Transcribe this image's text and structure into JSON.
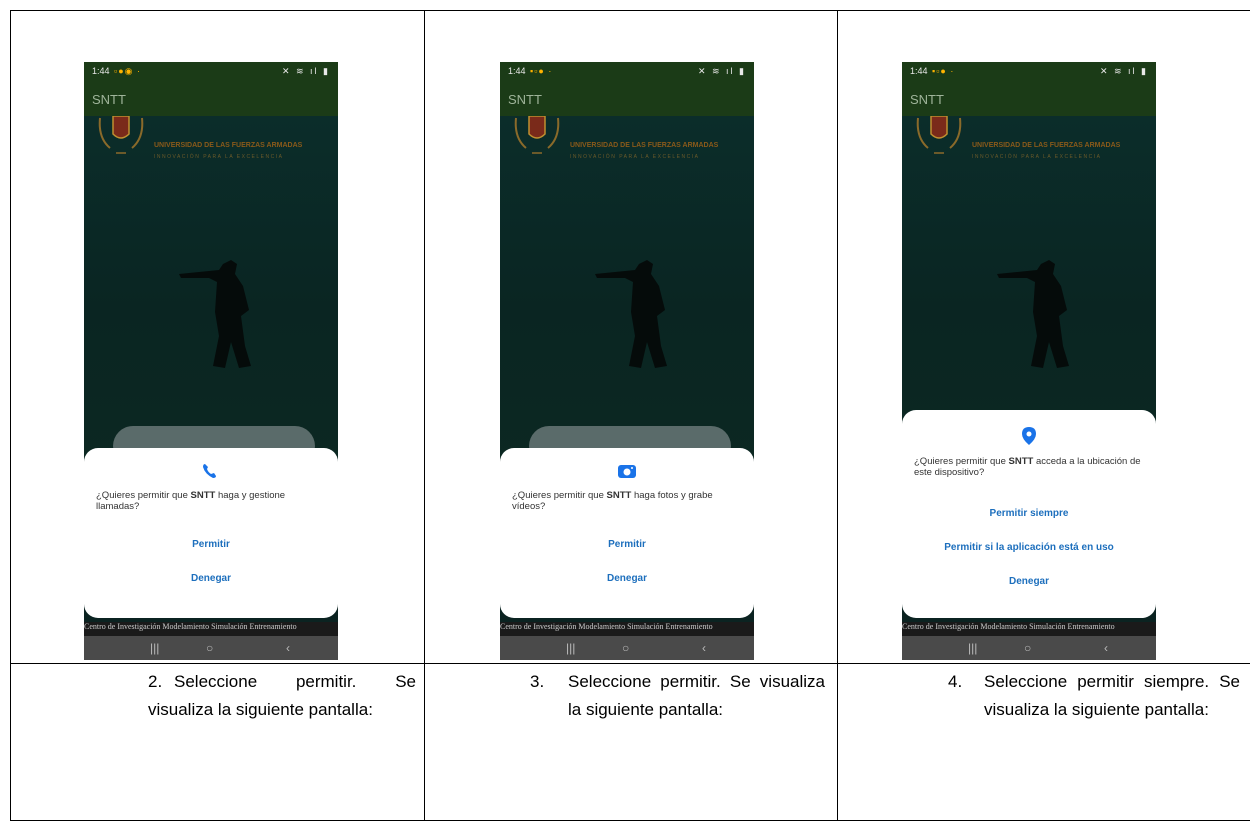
{
  "columns": [
    {
      "status_time": "1:44",
      "app_title": "SNTT",
      "university": "UNIVERSIDAD DE LAS FUERZAS ARMADAS",
      "motto": "INNOVACIÓN PARA LA EXCELENCIA",
      "dialog": {
        "icon": "phone-icon",
        "text_before": "¿Quieres permitir que ",
        "app": "SNTT",
        "text_after": " haga y gestione llamadas?",
        "buttons": [
          "Permitir",
          "Denegar"
        ]
      },
      "footer_strip": "Centro de Investigación Modelamiento Simulación Entrenamiento",
      "caption_num": "2.",
      "caption_text": "Seleccione permitir. Se visualiza la siguiente pantalla:"
    },
    {
      "status_time": "1:44",
      "app_title": "SNTT",
      "university": "UNIVERSIDAD DE LAS FUERZAS ARMADAS",
      "motto": "INNOVACIÓN PARA LA EXCELENCIA",
      "dialog": {
        "icon": "camera-icon",
        "text_before": "¿Quieres permitir que ",
        "app": "SNTT",
        "text_after": " haga fotos y grabe vídeos?",
        "buttons": [
          "Permitir",
          "Denegar"
        ]
      },
      "footer_strip": "Centro de Investigación Modelamiento Simulación Entrenamiento",
      "caption_num": "3.",
      "caption_text": "Seleccione permitir. Se visualiza la siguiente pantalla:"
    },
    {
      "status_time": "1:44",
      "app_title": "SNTT",
      "university": "UNIVERSIDAD DE LAS FUERZAS ARMADAS",
      "motto": "INNOVACIÓN PARA LA EXCELENCIA",
      "dialog": {
        "icon": "location-pin-icon",
        "text_before": "¿Quieres permitir que ",
        "app": "SNTT",
        "text_after": " acceda a la ubicación de este dispositivo?",
        "buttons": [
          "Permitir siempre",
          "Permitir si la aplicación está en uso",
          "Denegar"
        ]
      },
      "footer_strip": "Centro de Investigación Modelamiento Simulación Entrenamiento",
      "caption_num": "4.",
      "caption_text": "Seleccione permitir siempre. Se visualiza la siguiente pantalla:"
    }
  ],
  "navbar": {
    "recents": "|||",
    "home": "○",
    "back": "‹"
  }
}
